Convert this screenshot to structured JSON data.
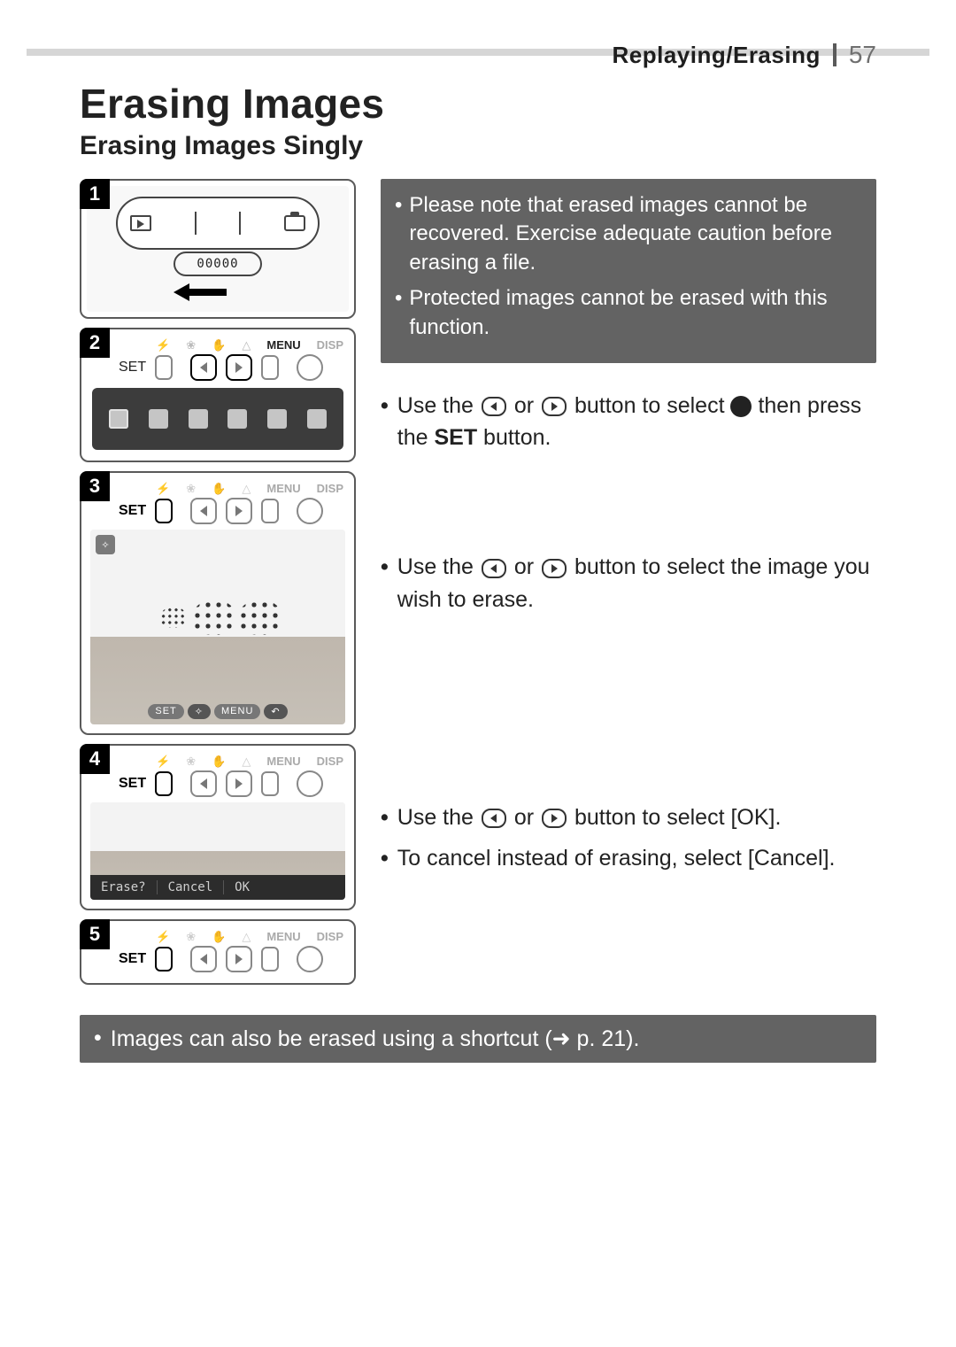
{
  "header": {
    "section": "Replaying/Erasing",
    "page": "57"
  },
  "title": "Erasing Images",
  "subtitle": "Erasing Images Singly",
  "steps": {
    "s1": {
      "num": "1",
      "counter": "00000"
    },
    "s2": {
      "num": "2",
      "labels": [
        "",
        "",
        "",
        "",
        "MENU",
        "DISP"
      ],
      "set": "SET"
    },
    "s3": {
      "num": "3",
      "labels": [
        "",
        "",
        "",
        "",
        "MENU",
        "DISP"
      ],
      "set": "SET",
      "badge": "",
      "pill1": "SET",
      "pill2": "MENU"
    },
    "s4": {
      "num": "4",
      "labels": [
        "",
        "",
        "",
        "",
        "MENU",
        "DISP"
      ],
      "set": "SET",
      "prompt": "Erase?",
      "cancel": "Cancel",
      "ok": "OK"
    },
    "s5": {
      "num": "5",
      "labels": [
        "",
        "",
        "",
        "",
        "MENU",
        "DISP"
      ],
      "set": "SET"
    }
  },
  "callout": {
    "item1": "Please note that erased images cannot be recovered. Exercise adequate caution before erasing a file.",
    "item2": "Protected images cannot be erased with this function."
  },
  "body": {
    "p1_a": "Use the ",
    "p1_b": " or ",
    "p1_c": " button to select ",
    "p1_d": " then press the ",
    "p1_set": "SET",
    "p1_e": " button.",
    "p2_a": "Use the ",
    "p2_b": " or ",
    "p2_c": " button to select the image you wish to erase.",
    "p3_a": "Use the ",
    "p3_b": " or ",
    "p3_c": " button to select [OK].",
    "p4": "To cancel instead of erasing, select [Cancel]."
  },
  "footer": {
    "text_a": "Images can also be erased using a shortcut (",
    "arrow": "➜",
    "text_b": " p. 21)."
  }
}
